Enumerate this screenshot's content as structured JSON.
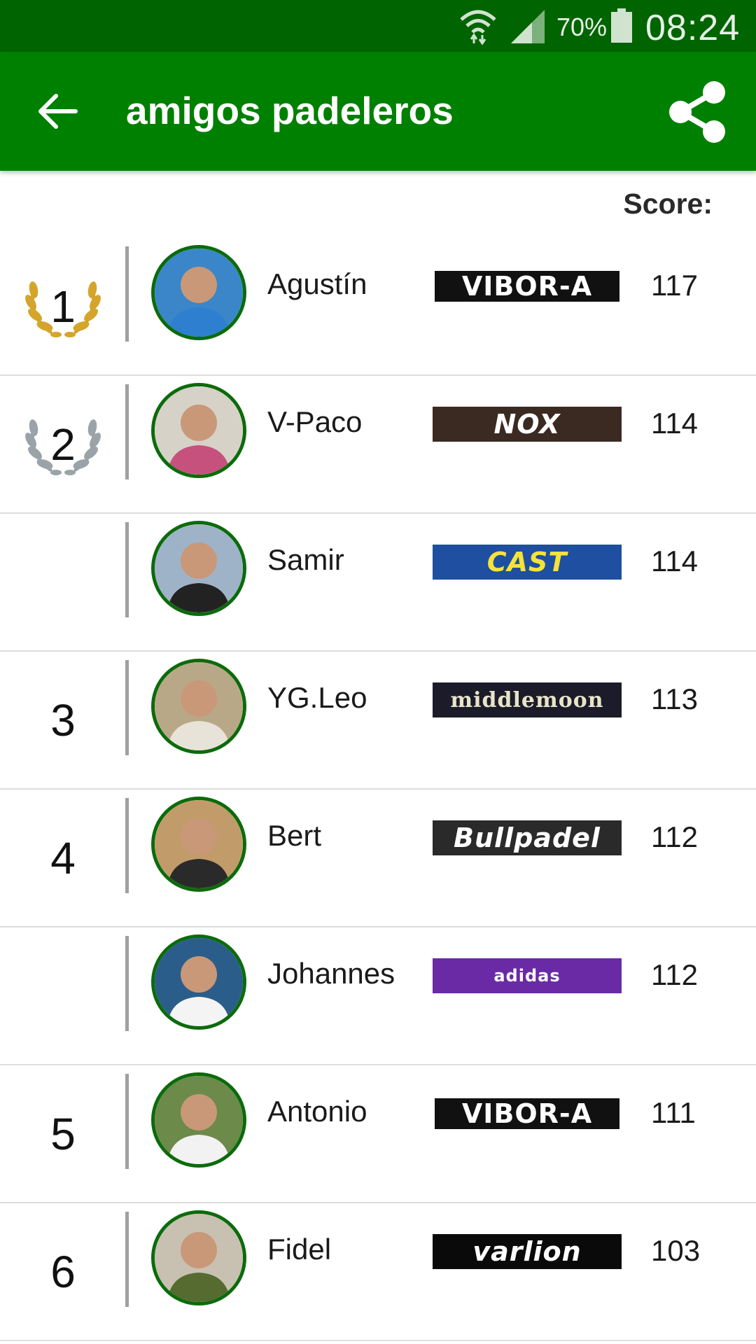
{
  "status_bar": {
    "battery_percent": "70%",
    "time": "08:24"
  },
  "app_bar": {
    "title": "amigos padeleros"
  },
  "score_label": "Score:",
  "colors": {
    "status_bar": "#006400",
    "app_bar": "#008000",
    "avatar_border": "#0b6b0b",
    "gold_laurel": "#d4a52a",
    "silver_laurel": "#9aa3a8"
  },
  "players": [
    {
      "rank": "1",
      "laurel": "gold",
      "name": "Agustín",
      "brand": "VIBOR-A",
      "brand_style": "vibora",
      "score": "117"
    },
    {
      "rank": "2",
      "laurel": "silver",
      "name": "V-Paco",
      "brand": "NOX",
      "brand_style": "nox",
      "score": "114"
    },
    {
      "rank": "",
      "laurel": "none",
      "name": "Samir",
      "brand": "CAST",
      "brand_style": "cast",
      "score": "114"
    },
    {
      "rank": "3",
      "laurel": "none",
      "name": "YG.Leo",
      "brand": "middlemoon",
      "brand_style": "middlemoon",
      "score": "113"
    },
    {
      "rank": "4",
      "laurel": "none",
      "name": "Bert",
      "brand": "Bullpadel",
      "brand_style": "bullpadel",
      "score": "112"
    },
    {
      "rank": "",
      "laurel": "none",
      "name": "Johannes",
      "brand": "adidas",
      "brand_style": "adidas",
      "score": "112"
    },
    {
      "rank": "5",
      "laurel": "none",
      "name": "Antonio",
      "brand": "VIBOR-A",
      "brand_style": "vibora",
      "score": "111"
    },
    {
      "rank": "6",
      "laurel": "none",
      "name": "Fidel",
      "brand": "varlion",
      "brand_style": "varlion",
      "score": "103"
    }
  ]
}
